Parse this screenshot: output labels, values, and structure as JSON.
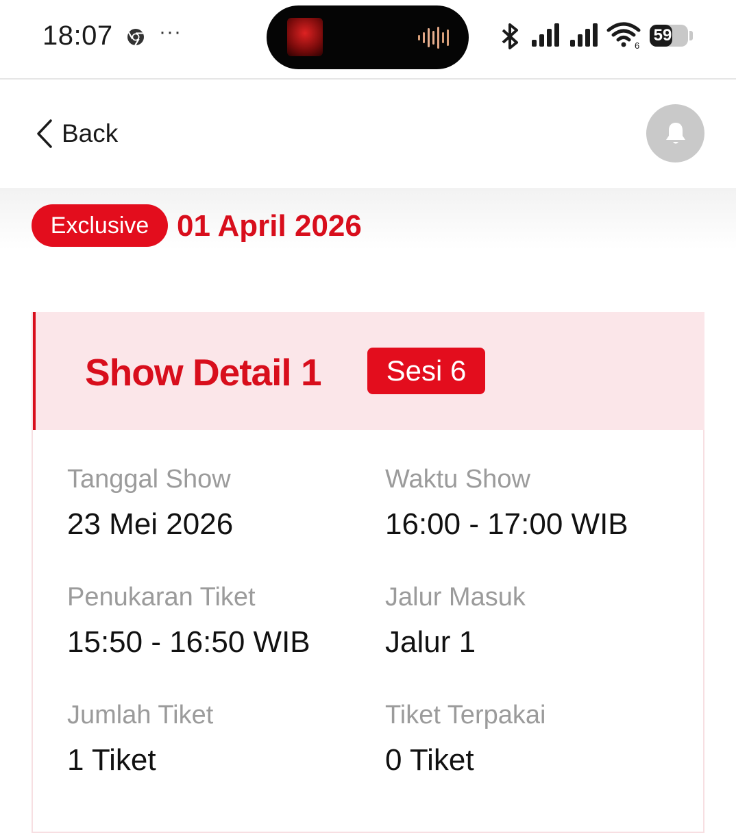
{
  "status_bar": {
    "time": "18:07",
    "overflow_indicator": "···",
    "battery_level": "59",
    "battery_fraction": 0.59,
    "wifi_label": "6"
  },
  "nav": {
    "back_label": "Back"
  },
  "header": {
    "badge": "Exclusive",
    "date": "01 April 2026"
  },
  "show_detail": {
    "title": "Show Detail 1",
    "session": "Sesi 6",
    "fields": [
      {
        "label": "Tanggal Show",
        "value": "23 Mei 2026"
      },
      {
        "label": "Waktu Show",
        "value": "16:00 - 17:00 WIB"
      },
      {
        "label": "Penukaran Tiket",
        "value": "15:50 - 16:50 WIB"
      },
      {
        "label": "Jalur Masuk",
        "value": "Jalur 1"
      },
      {
        "label": "Jumlah Tiket",
        "value": "1 Tiket"
      },
      {
        "label": "Tiket Terpakai",
        "value": "0 Tiket"
      }
    ]
  },
  "colors": {
    "accent": "#e30d1d",
    "accent_text": "#d80e1c",
    "header_bg": "#fbe6e9",
    "label_gray": "#9b9b9b"
  },
  "icons": [
    "chrome-icon",
    "bluetooth-icon",
    "signal-icon",
    "wifi-icon",
    "battery-icon",
    "back-chevron-icon",
    "bell-icon"
  ]
}
